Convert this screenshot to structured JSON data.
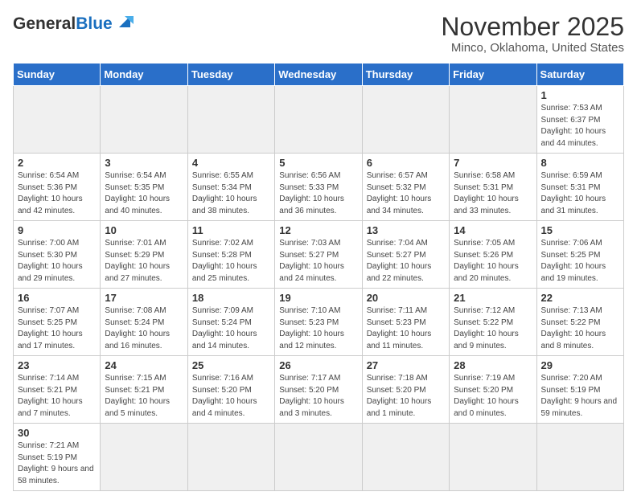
{
  "header": {
    "logo_general": "General",
    "logo_blue": "Blue",
    "title": "November 2025",
    "subtitle": "Minco, Oklahoma, United States"
  },
  "days_of_week": [
    "Sunday",
    "Monday",
    "Tuesday",
    "Wednesday",
    "Thursday",
    "Friday",
    "Saturday"
  ],
  "weeks": [
    [
      {
        "day": "",
        "empty": true
      },
      {
        "day": "",
        "empty": true
      },
      {
        "day": "",
        "empty": true
      },
      {
        "day": "",
        "empty": true
      },
      {
        "day": "",
        "empty": true
      },
      {
        "day": "",
        "empty": true
      },
      {
        "day": "1",
        "sunrise": "Sunrise: 7:53 AM",
        "sunset": "Sunset: 6:37 PM",
        "daylight": "Daylight: 10 hours and 44 minutes."
      }
    ],
    [
      {
        "day": "2",
        "sunrise": "Sunrise: 6:54 AM",
        "sunset": "Sunset: 5:36 PM",
        "daylight": "Daylight: 10 hours and 42 minutes."
      },
      {
        "day": "3",
        "sunrise": "Sunrise: 6:54 AM",
        "sunset": "Sunset: 5:35 PM",
        "daylight": "Daylight: 10 hours and 40 minutes."
      },
      {
        "day": "4",
        "sunrise": "Sunrise: 6:55 AM",
        "sunset": "Sunset: 5:34 PM",
        "daylight": "Daylight: 10 hours and 38 minutes."
      },
      {
        "day": "5",
        "sunrise": "Sunrise: 6:56 AM",
        "sunset": "Sunset: 5:33 PM",
        "daylight": "Daylight: 10 hours and 36 minutes."
      },
      {
        "day": "6",
        "sunrise": "Sunrise: 6:57 AM",
        "sunset": "Sunset: 5:32 PM",
        "daylight": "Daylight: 10 hours and 34 minutes."
      },
      {
        "day": "7",
        "sunrise": "Sunrise: 6:58 AM",
        "sunset": "Sunset: 5:31 PM",
        "daylight": "Daylight: 10 hours and 33 minutes."
      },
      {
        "day": "8",
        "sunrise": "Sunrise: 6:59 AM",
        "sunset": "Sunset: 5:31 PM",
        "daylight": "Daylight: 10 hours and 31 minutes."
      }
    ],
    [
      {
        "day": "9",
        "sunrise": "Sunrise: 7:00 AM",
        "sunset": "Sunset: 5:30 PM",
        "daylight": "Daylight: 10 hours and 29 minutes."
      },
      {
        "day": "10",
        "sunrise": "Sunrise: 7:01 AM",
        "sunset": "Sunset: 5:29 PM",
        "daylight": "Daylight: 10 hours and 27 minutes."
      },
      {
        "day": "11",
        "sunrise": "Sunrise: 7:02 AM",
        "sunset": "Sunset: 5:28 PM",
        "daylight": "Daylight: 10 hours and 25 minutes."
      },
      {
        "day": "12",
        "sunrise": "Sunrise: 7:03 AM",
        "sunset": "Sunset: 5:27 PM",
        "daylight": "Daylight: 10 hours and 24 minutes."
      },
      {
        "day": "13",
        "sunrise": "Sunrise: 7:04 AM",
        "sunset": "Sunset: 5:27 PM",
        "daylight": "Daylight: 10 hours and 22 minutes."
      },
      {
        "day": "14",
        "sunrise": "Sunrise: 7:05 AM",
        "sunset": "Sunset: 5:26 PM",
        "daylight": "Daylight: 10 hours and 20 minutes."
      },
      {
        "day": "15",
        "sunrise": "Sunrise: 7:06 AM",
        "sunset": "Sunset: 5:25 PM",
        "daylight": "Daylight: 10 hours and 19 minutes."
      }
    ],
    [
      {
        "day": "16",
        "sunrise": "Sunrise: 7:07 AM",
        "sunset": "Sunset: 5:25 PM",
        "daylight": "Daylight: 10 hours and 17 minutes."
      },
      {
        "day": "17",
        "sunrise": "Sunrise: 7:08 AM",
        "sunset": "Sunset: 5:24 PM",
        "daylight": "Daylight: 10 hours and 16 minutes."
      },
      {
        "day": "18",
        "sunrise": "Sunrise: 7:09 AM",
        "sunset": "Sunset: 5:24 PM",
        "daylight": "Daylight: 10 hours and 14 minutes."
      },
      {
        "day": "19",
        "sunrise": "Sunrise: 7:10 AM",
        "sunset": "Sunset: 5:23 PM",
        "daylight": "Daylight: 10 hours and 12 minutes."
      },
      {
        "day": "20",
        "sunrise": "Sunrise: 7:11 AM",
        "sunset": "Sunset: 5:23 PM",
        "daylight": "Daylight: 10 hours and 11 minutes."
      },
      {
        "day": "21",
        "sunrise": "Sunrise: 7:12 AM",
        "sunset": "Sunset: 5:22 PM",
        "daylight": "Daylight: 10 hours and 9 minutes."
      },
      {
        "day": "22",
        "sunrise": "Sunrise: 7:13 AM",
        "sunset": "Sunset: 5:22 PM",
        "daylight": "Daylight: 10 hours and 8 minutes."
      }
    ],
    [
      {
        "day": "23",
        "sunrise": "Sunrise: 7:14 AM",
        "sunset": "Sunset: 5:21 PM",
        "daylight": "Daylight: 10 hours and 7 minutes."
      },
      {
        "day": "24",
        "sunrise": "Sunrise: 7:15 AM",
        "sunset": "Sunset: 5:21 PM",
        "daylight": "Daylight: 10 hours and 5 minutes."
      },
      {
        "day": "25",
        "sunrise": "Sunrise: 7:16 AM",
        "sunset": "Sunset: 5:20 PM",
        "daylight": "Daylight: 10 hours and 4 minutes."
      },
      {
        "day": "26",
        "sunrise": "Sunrise: 7:17 AM",
        "sunset": "Sunset: 5:20 PM",
        "daylight": "Daylight: 10 hours and 3 minutes."
      },
      {
        "day": "27",
        "sunrise": "Sunrise: 7:18 AM",
        "sunset": "Sunset: 5:20 PM",
        "daylight": "Daylight: 10 hours and 1 minute."
      },
      {
        "day": "28",
        "sunrise": "Sunrise: 7:19 AM",
        "sunset": "Sunset: 5:20 PM",
        "daylight": "Daylight: 10 hours and 0 minutes."
      },
      {
        "day": "29",
        "sunrise": "Sunrise: 7:20 AM",
        "sunset": "Sunset: 5:19 PM",
        "daylight": "Daylight: 9 hours and 59 minutes."
      }
    ],
    [
      {
        "day": "30",
        "sunrise": "Sunrise: 7:21 AM",
        "sunset": "Sunset: 5:19 PM",
        "daylight": "Daylight: 9 hours and 58 minutes."
      },
      {
        "day": "",
        "empty": true
      },
      {
        "day": "",
        "empty": true
      },
      {
        "day": "",
        "empty": true
      },
      {
        "day": "",
        "empty": true
      },
      {
        "day": "",
        "empty": true
      },
      {
        "day": "",
        "empty": true
      }
    ]
  ]
}
